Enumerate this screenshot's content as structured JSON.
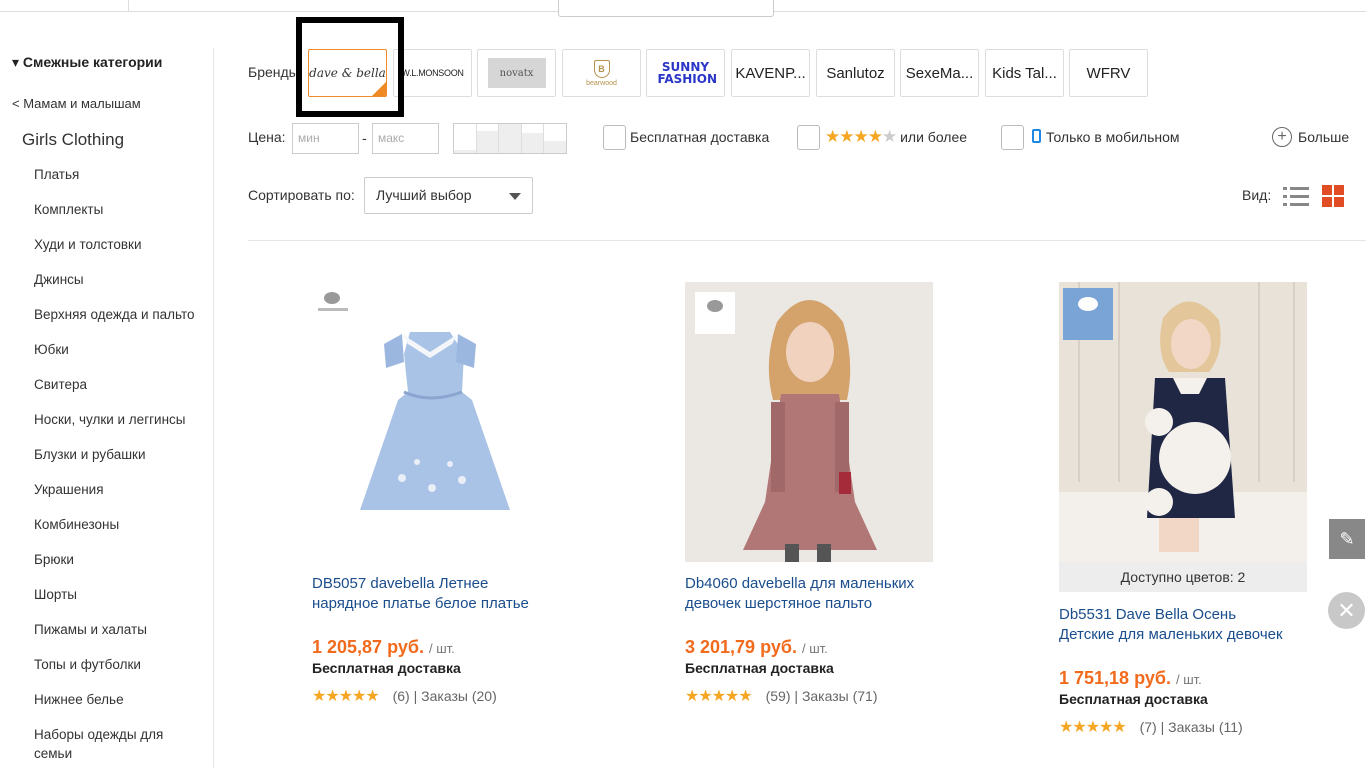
{
  "sidebar": {
    "heading": "▾ Смежные категории",
    "back_link": "< Мамам и малышам",
    "current": "Girls Clothing",
    "items": [
      "Платья",
      "Комплекты",
      "Худи и толстовки",
      "Джинсы",
      "Верхняя одежда и пальто",
      "Юбки",
      "Свитера",
      "Носки, чулки и леггинсы",
      "Блузки и рубашки",
      "Украшения",
      "Комбинезоны",
      "Брюки",
      "Шорты",
      "Пижамы и халаты",
      "Топы и футболки",
      "Нижнее белье",
      "Наборы одежды для",
      "семьи"
    ]
  },
  "filters": {
    "brands_label": "Бренды",
    "brands": [
      "dave & bella",
      "W.L.MONSOON",
      "novatx",
      "bearwood",
      "SUNNY FASHION",
      "KAVENP...",
      "Sanlutoz",
      "SexeMa...",
      "Kids Tal...",
      "WFRV"
    ],
    "price_label": "Цена:",
    "price_min_placeholder": "мин",
    "price_max_placeholder": "макс",
    "price_dash": "-",
    "free_shipping": "Бесплатная доставка",
    "rating_suffix": "или более",
    "mobile_only": "Только в мобильном",
    "more": "Больше",
    "sort_label": "Сортировать по:",
    "sort_value": "Лучший выбор",
    "view_label": "Вид:"
  },
  "products": [
    {
      "title_line1": "DB5057 davebella Летнее",
      "title_line2": "нарядное платье белое платье",
      "price": "1 205,87 руб.",
      "unit": "/ шт.",
      "shipping": "Бесплатная доставка",
      "reviews": "(6)",
      "orders": "Заказы (20)",
      "rating": 5
    },
    {
      "title_line1": "Db4060 davebella для маленьких",
      "title_line2": "девочек шерстяное пальто",
      "price": "3 201,79 руб.",
      "unit": "/ шт.",
      "shipping": "Бесплатная доставка",
      "reviews": "(59)",
      "orders": "Заказы (71)",
      "rating": 5
    },
    {
      "colors": "Доступно цветов: 2",
      "title_line1": "Db5531 Dave Bella Осень",
      "title_line2": "Детские для маленьких девочек",
      "price": "1 751,18 руб.",
      "unit": "/ шт.",
      "shipping": "Бесплатная доставка",
      "reviews": "(7)",
      "orders": "Заказы (11)",
      "rating": 5
    }
  ],
  "colors": {
    "accent": "#f26b1d",
    "link": "#1a4d8c",
    "star": "#f5a623",
    "grid_icon": "#e24c24"
  }
}
